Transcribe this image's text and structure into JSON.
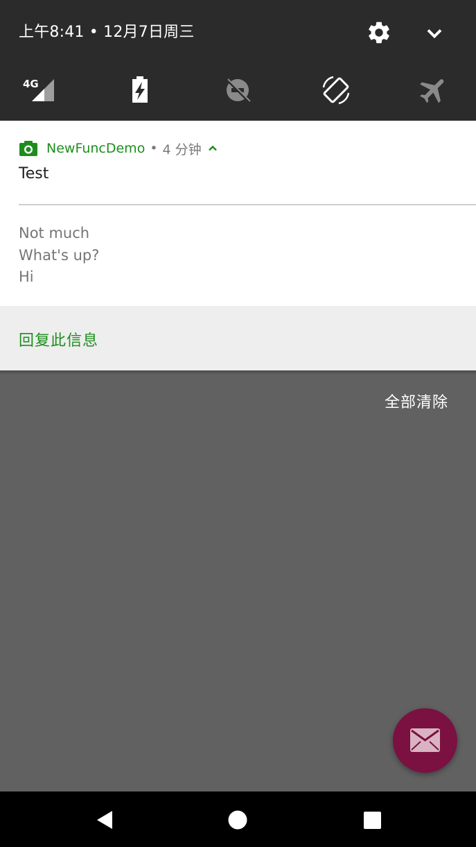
{
  "quick_settings": {
    "datetime": "上午8:41 • 12月7日周三",
    "settings_icon": "gear-icon",
    "expand_icon": "chevron-down-icon",
    "tiles": [
      {
        "name": "cellular-signal-icon",
        "label": "4G"
      },
      {
        "name": "battery-saver-icon"
      },
      {
        "name": "do-not-disturb-icon"
      },
      {
        "name": "auto-rotate-icon"
      },
      {
        "name": "airplane-mode-icon"
      }
    ]
  },
  "notification": {
    "app_icon": "camera-icon",
    "app_name": "NewFuncDemo",
    "separator": "•",
    "time_ago": "4 分钟",
    "title": "Test",
    "messages": [
      "Not much",
      "What's up?",
      "Hi"
    ],
    "reply_label": "回复此信息",
    "accent_color": "#1d8e1d"
  },
  "clear_all_label": "全部清除",
  "fab": {
    "icon": "mail-icon",
    "color": "#7a1140"
  },
  "nav": {
    "back_icon": "back-icon",
    "home_icon": "home-icon",
    "recents_icon": "recents-icon"
  }
}
